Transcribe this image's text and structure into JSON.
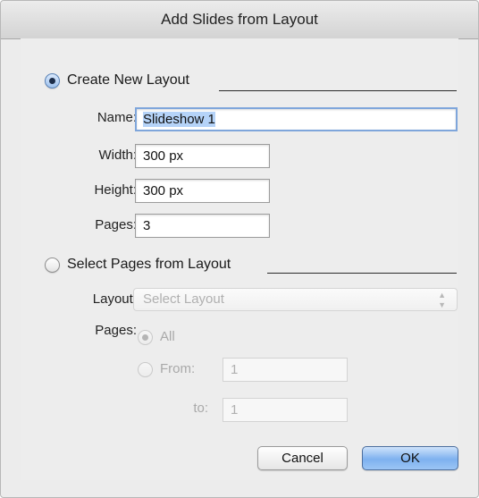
{
  "dialog": {
    "title": "Add Slides from Layout"
  },
  "create_new": {
    "heading": "Create New Layout",
    "selected": true,
    "name_label": "Name:",
    "name_value": "Slideshow 1",
    "width_label": "Width:",
    "width_value": "300 px",
    "height_label": "Height:",
    "height_value": "300 px",
    "pages_label": "Pages:",
    "pages_value": "3"
  },
  "select_pages": {
    "heading": "Select Pages from Layout",
    "selected": false,
    "layout_label": "Layout:",
    "layout_placeholder": "Select Layout",
    "pages_label": "Pages:",
    "all_label": "All",
    "from_label": "From:",
    "from_value": "1",
    "to_label": "to:",
    "to_value": "1"
  },
  "buttons": {
    "cancel": "Cancel",
    "ok": "OK"
  },
  "colors": {
    "focus_ring": "#7fa6db",
    "primary_button": "#7eb1ef",
    "disabled_text": "#a9a9a9"
  }
}
